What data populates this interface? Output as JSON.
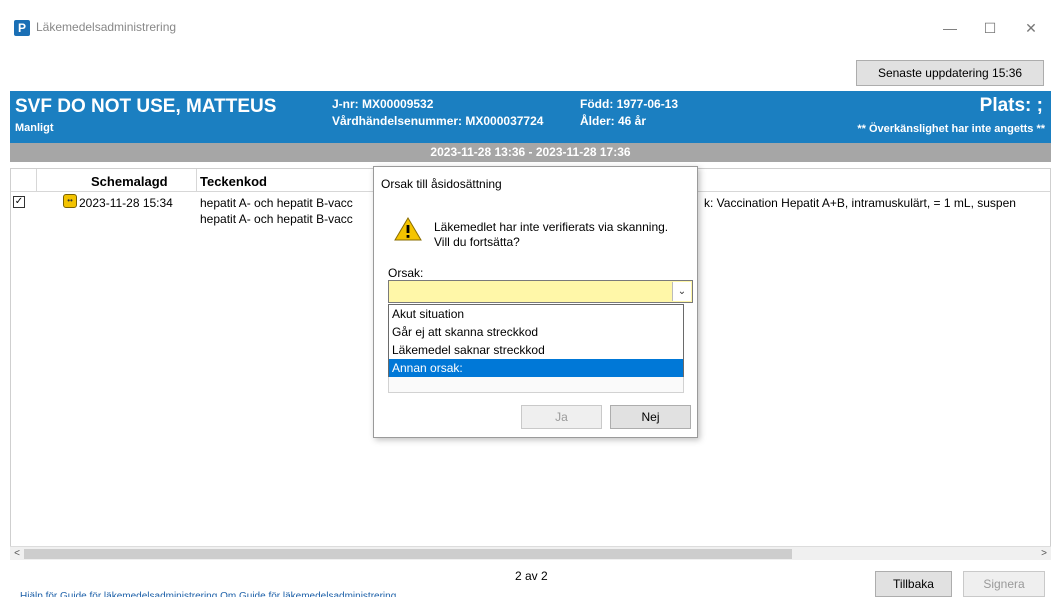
{
  "window": {
    "title": "Läkemedelsadministrering",
    "app_icon_letter": "P",
    "minimize": "—",
    "maximize": "☐",
    "close": "✕"
  },
  "toolbar": {
    "last_updated": "Senaste uppdatering 15:36"
  },
  "patient": {
    "name": "SVF DO NOT USE, MATTEUS",
    "sex": "Manligt",
    "jnr": "J-nr: MX00009532",
    "vardhandelse": "Vårdhändelsenummer: MX000037724",
    "born": "Född: 1977-06-13",
    "age": "Ålder: 46 år",
    "place": "Plats: ;",
    "allergy": "** Överkänslighet har inte angetts **",
    "banner_color": "#1b7fc1"
  },
  "interval": "2023-11-28 13:36  - 2023-11-28 17:36",
  "table": {
    "headers": {
      "schemalagd": "Schemalagd",
      "teckenkod": "Teckenkod"
    },
    "rows": [
      {
        "checked": "✓",
        "icon": "calendar-warning-icon",
        "schemalagd": "2023-11-28 15:34",
        "teckenkod_line1": "hepatit A- och hepatit B-vacc",
        "teckenkod_line2": "hepatit A- och hepatit B-vacc",
        "description": "k: Vaccination Hepatit A+B, intramuskulärt, = 1 mL, suspen"
      }
    ]
  },
  "dialog": {
    "title": "Orsak till åsidosättning",
    "message_line1": "Läkemedlet har inte verifierats via skanning.",
    "message_line2": "Vill du fortsätta?",
    "reason_label": "Orsak:",
    "reason_value": "",
    "options": [
      "Akut situation",
      "Går ej att skanna streckkod",
      "Läkemedel saknar streckkod",
      "Annan orsak:"
    ],
    "selected_option": "Annan orsak:",
    "ja": "Ja",
    "nej": "Nej",
    "select_color": "#fff7a8",
    "selection_color": "#0078d7"
  },
  "footer": {
    "pager": "2 av 2",
    "back": "Tillbaka",
    "sign": "Signera",
    "help_links": "Hjälp för Guide för läkemedelsadministrering    Om Guide för läkemedelsadministrering"
  }
}
